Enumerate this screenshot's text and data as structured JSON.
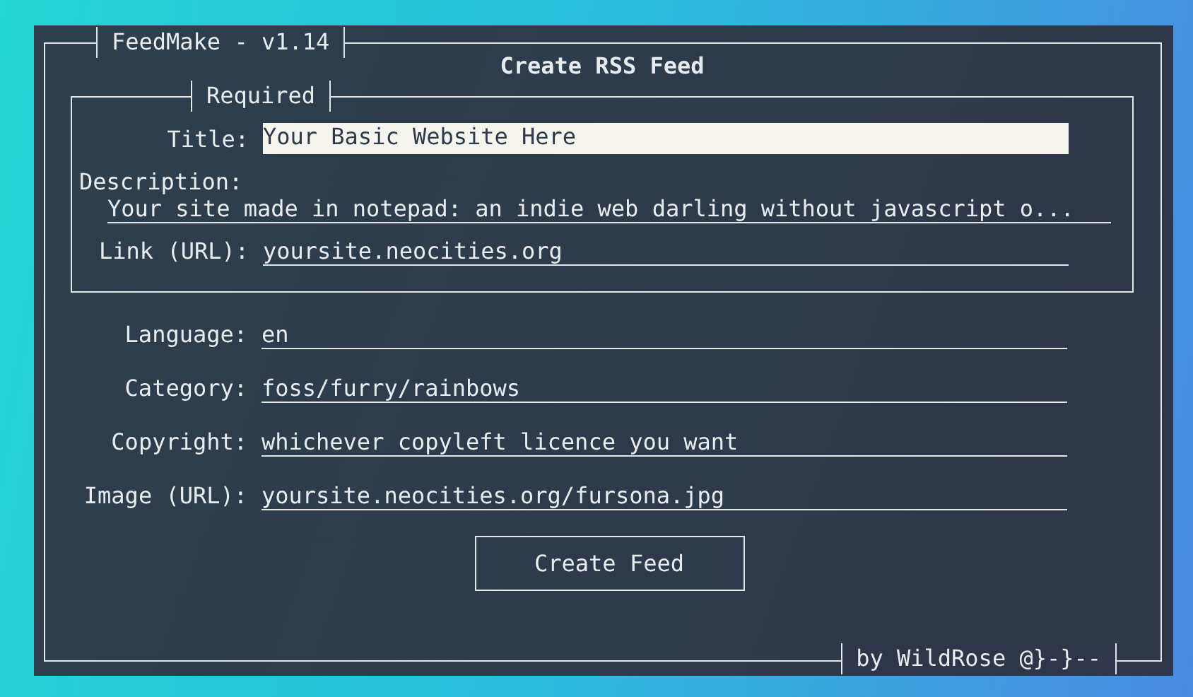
{
  "window": {
    "title": "FeedMake - v1.14",
    "footer": "by WildRose @}-}--"
  },
  "form": {
    "heading": "Create RSS Feed",
    "required_group": {
      "title": "Required",
      "fields": [
        {
          "kind": "inline",
          "label": "Title:",
          "value": "Your Basic Website Here",
          "focused": true
        },
        {
          "kind": "stacked",
          "label": "Description:",
          "value": "Your site made in notepad: an indie web darling without javascript o...",
          "focused": false
        },
        {
          "kind": "inline",
          "label": "Link (URL):",
          "value": "yoursite.neocities.org",
          "focused": false
        }
      ]
    },
    "fields": [
      {
        "kind": "inline",
        "label": "Language:",
        "value": "en",
        "focused": false
      },
      {
        "kind": "inline",
        "label": "Category:",
        "value": "foss/furry/rainbows",
        "focused": false
      },
      {
        "kind": "inline",
        "label": "Copyright:",
        "value": "whichever copyleft licence you want",
        "focused": false
      },
      {
        "kind": "inline",
        "label": "Image (URL):",
        "value": "yoursite.neocities.org/fursona.jpg",
        "focused": false
      }
    ],
    "button": "Create Feed"
  }
}
